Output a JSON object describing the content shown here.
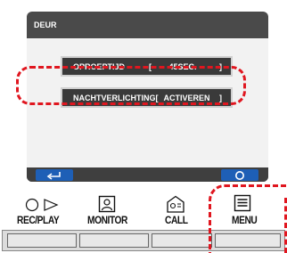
{
  "screen": {
    "title": "DEUR",
    "settings": [
      {
        "label": "OPROEPTIJD",
        "open": "[",
        "value": "45SEC.",
        "close": "]"
      },
      {
        "label": "NACHTVERLICHTING",
        "open": "[",
        "value": "ACTIVEREN",
        "close": "]"
      }
    ],
    "softkeys": {
      "back_icon": "return-arrow-icon",
      "ok_icon": "circle-icon"
    }
  },
  "hardware": {
    "buttons": [
      {
        "label": "REC/PLAY",
        "icon": "record-play-icon"
      },
      {
        "label": "MONITOR",
        "icon": "monitor-icon"
      },
      {
        "label": "CALL",
        "icon": "call-icon"
      },
      {
        "label": "MENU",
        "icon": "menu-icon"
      }
    ]
  },
  "colors": {
    "highlight": "#e0161f",
    "softkey": "#1e5fb6",
    "screen_frame": "#4a4a4a"
  }
}
